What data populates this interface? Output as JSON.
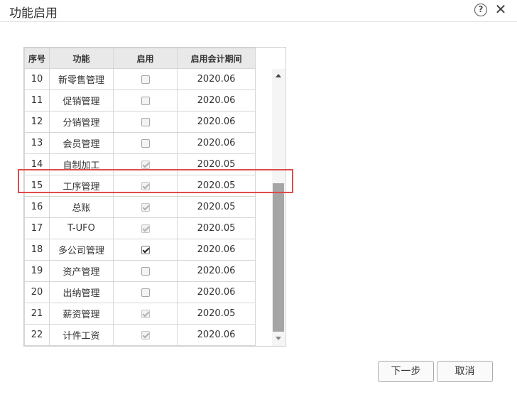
{
  "dialog": {
    "title": "功能启用",
    "help_icon": "question-circle-icon",
    "help_glyph": "?",
    "close_icon": "close-icon",
    "close_glyph": "✕"
  },
  "grid": {
    "headers": [
      "序号",
      "功能",
      "启用",
      "启用会计期间"
    ],
    "rows": [
      {
        "no": "10",
        "name": "新零售管理",
        "enabled": "unchecked",
        "period": "2020.06"
      },
      {
        "no": "11",
        "name": "促销管理",
        "enabled": "unchecked",
        "period": "2020.06"
      },
      {
        "no": "12",
        "name": "分销管理",
        "enabled": "unchecked",
        "period": "2020.06"
      },
      {
        "no": "13",
        "name": "会员管理",
        "enabled": "unchecked",
        "period": "2020.06"
      },
      {
        "no": "14",
        "name": "自制加工",
        "enabled": "disabled-checked",
        "period": "2020.05"
      },
      {
        "no": "15",
        "name": "工序管理",
        "enabled": "disabled-checked",
        "period": "2020.05"
      },
      {
        "no": "16",
        "name": "总账",
        "enabled": "disabled-checked",
        "period": "2020.05"
      },
      {
        "no": "17",
        "name": "T-UFO",
        "enabled": "disabled-checked",
        "period": "2020.05"
      },
      {
        "no": "18",
        "name": "多公司管理",
        "enabled": "checked",
        "period": "2020.06"
      },
      {
        "no": "19",
        "name": "资产管理",
        "enabled": "unchecked",
        "period": "2020.06"
      },
      {
        "no": "20",
        "name": "出纳管理",
        "enabled": "unchecked",
        "period": "2020.06"
      },
      {
        "no": "21",
        "name": "薪资管理",
        "enabled": "disabled-checked",
        "period": "2020.05"
      },
      {
        "no": "22",
        "name": "计件工资",
        "enabled": "disabled-checked",
        "period": "2020.06"
      }
    ],
    "highlighted_row_no": "15",
    "highlight_color": "#e04a4a"
  },
  "footer": {
    "next_label": "下一步",
    "cancel_label": "取消"
  }
}
